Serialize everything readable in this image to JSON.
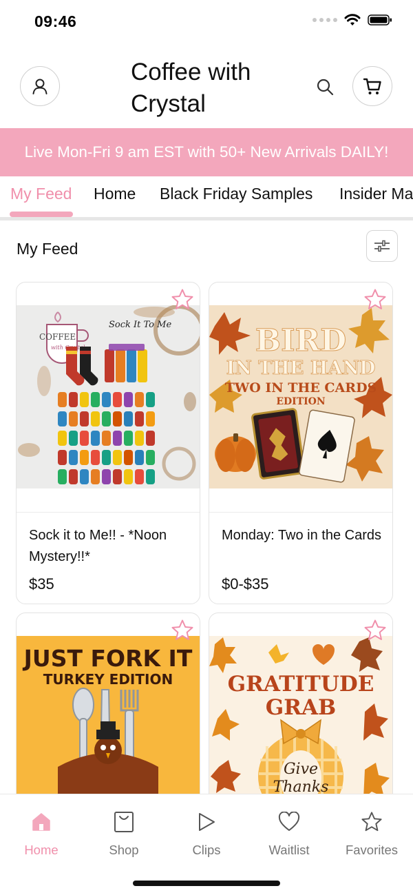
{
  "status_bar": {
    "time": "09:46"
  },
  "header": {
    "title": "Coffee with Crystal"
  },
  "promo": {
    "text": "Live Mon-Fri 9 am EST with 50+ New Arrivals DAILY!"
  },
  "tabs": [
    {
      "label": "My Feed",
      "active": true
    },
    {
      "label": "Home"
    },
    {
      "label": "Black Friday Samples"
    },
    {
      "label": "Insider Ma"
    }
  ],
  "feed": {
    "title": "My Feed"
  },
  "products": [
    {
      "name": "Sock it to Me!! - *Noon Mystery!!*",
      "price": "$35",
      "image_text": {
        "logo_brand": "COFFEE",
        "logo_script": "with Crystal",
        "badge": "Sock It To Me"
      }
    },
    {
      "name": "Monday: Two in the Cards",
      "price": "$0-$35",
      "image_text": {
        "line1": "BIRD",
        "line2": "IN THE HAND",
        "line3": "TWO IN THE CARDS",
        "line4": "EDITION"
      }
    },
    {
      "name": "",
      "price": "",
      "image_text": {
        "line1": "JUST FORK IT",
        "line2": "TURKEY EDITION"
      }
    },
    {
      "name": "",
      "price": "",
      "image_text": {
        "line1": "GRATITUDE",
        "line2": "GRAB",
        "line3": "Give",
        "line4": "Thanks"
      }
    }
  ],
  "bottom_nav": [
    {
      "label": "Home",
      "icon": "home-icon",
      "active": true
    },
    {
      "label": "Shop",
      "icon": "shopping-bag-icon"
    },
    {
      "label": "Clips",
      "icon": "play-icon"
    },
    {
      "label": "Waitlist",
      "icon": "heart-icon"
    },
    {
      "label": "Favorites",
      "icon": "star-icon"
    }
  ],
  "colors": {
    "accent_pink": "#f3a7bc",
    "active_pink": "#f08fab",
    "card_2_bg": "#f3e0c5",
    "card_3_bg": "#f8b73d",
    "card_4_bg": "#fbf1e2"
  }
}
